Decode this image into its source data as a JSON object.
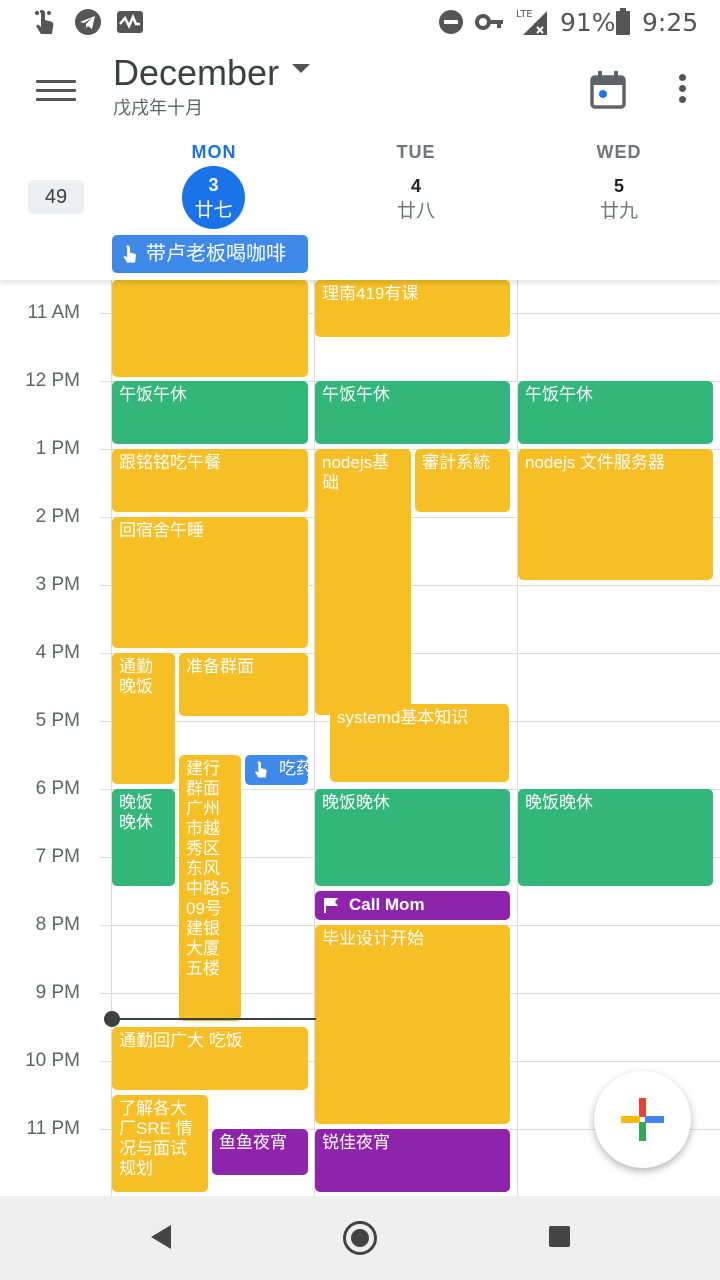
{
  "status_bar": {
    "battery": "91%",
    "time": "9:25",
    "network": "LTE",
    "icons": [
      "touch-icon",
      "telegram-icon",
      "activity-icon",
      "dnd-icon",
      "key-icon",
      "signal-icon",
      "battery-icon"
    ]
  },
  "header": {
    "month": "December",
    "lunar_month": "戊戌年十月",
    "week_number": "49"
  },
  "days": [
    {
      "dow": "MON",
      "date": "3",
      "lunar": "廿七",
      "today": true
    },
    {
      "dow": "TUE",
      "date": "4",
      "lunar": "廿八"
    },
    {
      "dow": "WED",
      "date": "5",
      "lunar": "廿九"
    }
  ],
  "allday_event": "带卢老板喝咖啡",
  "hours": [
    "11 AM",
    "12 PM",
    "1 PM",
    "2 PM",
    "3 PM",
    "4 PM",
    "5 PM",
    "6 PM",
    "7 PM",
    "8 PM",
    "9 PM",
    "10 PM",
    "11 PM"
  ],
  "events": {
    "mon_morning": "",
    "lunch_mon": "午饭午休",
    "lunch_mon_2": "跟铭铭吃午餐",
    "nap": "回宿舍午睡",
    "commute_dinner": "通勤 晚饭",
    "prep_interview": "准备群面",
    "ccb": "建行群面\n广州市越秀区东风中路509号建银大厦五楼",
    "medicine": "吃药",
    "dinner_mon": "晚饭晚休",
    "commute_back": "通勤回广大 吃饭",
    "sre": "了解各大厂SRE 情况与面试规划",
    "fish": "鱼鱼夜宵",
    "tue_class": "理南419有课",
    "lunch_tue": "午饭午休",
    "nodejs_basics": "nodejs基础",
    "audit": "審計系統",
    "systemd": "systemd基本知识",
    "dinner_tue": "晚饭晚休",
    "call_mom": "Call Mom",
    "thesis": "毕业设计开始",
    "ruijia": "锐佳夜宵",
    "lunch_wed": "午饭午休",
    "nodejs_file": "nodejs 文件服务器",
    "dinner_wed": "晚饭晚休"
  },
  "colors": {
    "yellow": "#f6bf26",
    "green": "#33b679",
    "purple": "#8e24aa",
    "blue": "#3f8ae8",
    "today_accent": "#1a73e8"
  }
}
